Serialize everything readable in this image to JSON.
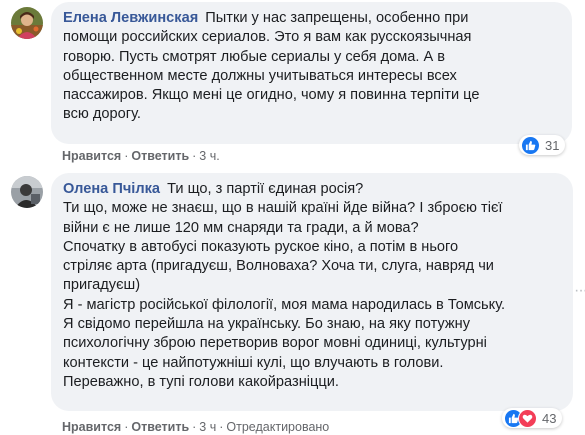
{
  "comments": [
    {
      "author": "Елена Левжинская",
      "lines": [
        "Пытки у нас запрещены, особенно при",
        "помощи российских сериалов. Это я вам как русскоязычная",
        "говорю. Пусть смотрят любые сериалы у себя дома. А в",
        "общественном месте должны учитываться интересы всех",
        "пассажиров. Якщо мені це огидно, чому я повинна терпіти це",
        "всю дорогу."
      ],
      "actions": {
        "like": "Нравится",
        "reply": "Ответить",
        "time": "3 ч."
      },
      "reactions": {
        "count": "31",
        "icons": [
          "like-icon"
        ]
      }
    },
    {
      "author": "Олена Пчілка",
      "lines": [
        "Ти що, з партії єдиная росія?",
        "Ти що, може не знаєш, що в нашій країні йде війна? І зброєю тієї",
        "війни є не лише 120 мм снаряди та гради, а й мова?",
        "Спочатку в автобусі показують руское кіно, а потім в нього",
        "стріляє арта (пригадуєш, Волноваха? Хоча ти, слуга, навряд чи",
        "пригадуєш)",
        "Я - магістр російської філології, моя мама народилась в Томську.",
        "Я свідомо перейшла на українську. Бо знаю, на яку потужну",
        "психологічну зброю перетворив ворог мовні одиниці, культурні",
        "контексти - це найпотужніші кулі, що влучають в голови.",
        "Переважно, в тупі голови какойразніцци."
      ],
      "actions": {
        "like": "Нравится",
        "reply": "Ответить",
        "time": "3 ч",
        "edited": "Отредактировано"
      },
      "reactions": {
        "count": "43",
        "icons": [
          "like-icon",
          "love-icon"
        ]
      }
    }
  ],
  "colors": {
    "author": "#385898",
    "bubble": "#f0f2f5",
    "like": "#1877f2",
    "love": "#f33e58",
    "meta": "#65676b"
  },
  "more_options_icon": "more-options-icon"
}
